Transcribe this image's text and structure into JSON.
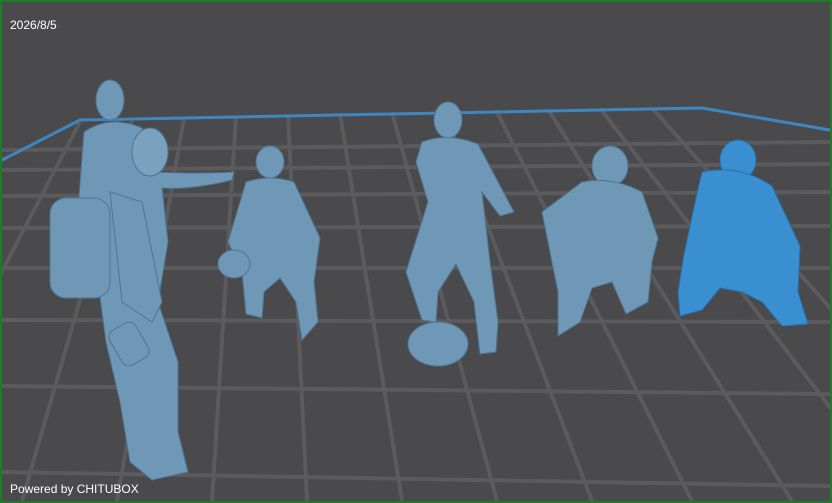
{
  "viewport": {
    "date": "2026/8/5",
    "powered_by": "Powered by CHITUBOX"
  },
  "colors": {
    "frame": "#1f7a2a",
    "background": "#4a4a4c",
    "grid": "#5a5a5c",
    "plate_edge": "#3f86c0",
    "model": "#6f98b6",
    "model_selected": "#3a8fd0"
  },
  "models": [
    {
      "name": "standing-woman-with-backpack",
      "selected": false
    },
    {
      "name": "crouching-figure-1",
      "selected": false
    },
    {
      "name": "standing-figure-with-bag",
      "selected": false
    },
    {
      "name": "crouching-figure-cap",
      "selected": false
    },
    {
      "name": "crouching-figure-hoodie",
      "selected": true
    }
  ]
}
